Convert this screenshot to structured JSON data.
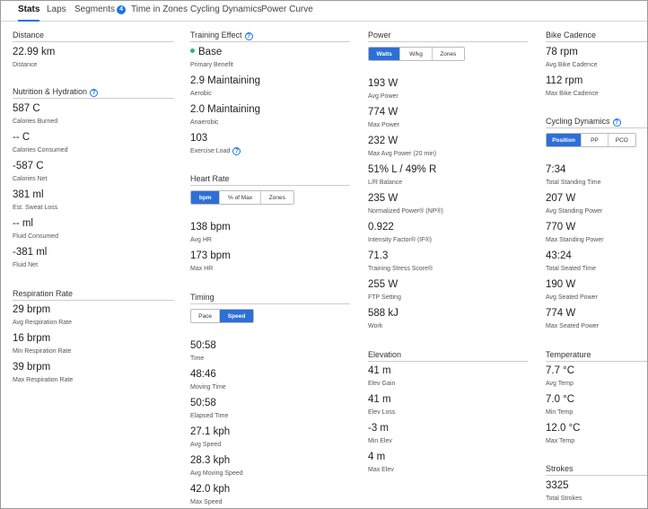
{
  "tabs": [
    {
      "label": "Stats",
      "active": true
    },
    {
      "label": "Laps"
    },
    {
      "label": "Segments",
      "badge": "4"
    },
    {
      "label": "Time in Zones"
    },
    {
      "label": "Cycling Dynamics"
    },
    {
      "label": "Power Curve"
    }
  ],
  "distance": {
    "title": "Distance",
    "items": [
      {
        "value": "22.99 km",
        "label": "Distance"
      }
    ]
  },
  "nutrition": {
    "title": "Nutrition & Hydration",
    "items": [
      {
        "value": "587 C",
        "label": "Calories Burned"
      },
      {
        "value": "-- C",
        "label": "Calories Consumed"
      },
      {
        "value": "-587 C",
        "label": "Calories Net"
      },
      {
        "value": "381 ml",
        "label": "Est. Sweat Loss"
      },
      {
        "value": "-- ml",
        "label": "Fluid Consumed"
      },
      {
        "value": "-381 ml",
        "label": "Fluid Net"
      }
    ]
  },
  "respiration": {
    "title": "Respiration Rate",
    "items": [
      {
        "value": "29 brpm",
        "label": "Avg Respiration Rate"
      },
      {
        "value": "16 brpm",
        "label": "Min Respiration Rate"
      },
      {
        "value": "39 brpm",
        "label": "Max Respiration Rate"
      }
    ]
  },
  "training": {
    "title": "Training Effect",
    "items": [
      {
        "value": "Base",
        "label": "Primary Benefit"
      },
      {
        "value": "2.9 Maintaining",
        "label": "Aerobic"
      },
      {
        "value": "2.0 Maintaining",
        "label": "Anaerobic"
      },
      {
        "value": "103",
        "label": "Exercise Load"
      }
    ],
    "dot_color": "#3bb273"
  },
  "heartrate": {
    "title": "Heart Rate",
    "toggle": [
      "bpm",
      "% of Max",
      "Zones"
    ],
    "items": [
      {
        "value": "138 bpm",
        "label": "Avg HR"
      },
      {
        "value": "173 bpm",
        "label": "Max HR"
      }
    ]
  },
  "timing": {
    "title": "Timing",
    "toggle": [
      "Pace",
      "Speed"
    ],
    "items": [
      {
        "value": "50:58",
        "label": "Time"
      },
      {
        "value": "48:46",
        "label": "Moving Time"
      },
      {
        "value": "50:58",
        "label": "Elapsed Time"
      },
      {
        "value": "27.1 kph",
        "label": "Avg Speed"
      },
      {
        "value": "28.3 kph",
        "label": "Avg Moving Speed"
      },
      {
        "value": "42.0 kph",
        "label": "Max Speed"
      }
    ]
  },
  "power": {
    "title": "Power",
    "toggle": [
      "Watts",
      "W/kg",
      "Zones"
    ],
    "items": [
      {
        "value": "193 W",
        "label": "Avg Power"
      },
      {
        "value": "774 W",
        "label": "Max Power"
      },
      {
        "value": "232 W",
        "label": "Max Avg Power (20 min)"
      },
      {
        "value": "51% L / 49% R",
        "label": "L/R Balance"
      },
      {
        "value": "235 W",
        "label": "Normalized Power® (NP®)"
      },
      {
        "value": "0.922",
        "label": "Intensity Factor® (IF®)"
      },
      {
        "value": "71.3",
        "label": "Training Stress Score®"
      },
      {
        "value": "255 W",
        "label": "FTP Setting"
      },
      {
        "value": "588 kJ",
        "label": "Work"
      }
    ]
  },
  "elevation": {
    "title": "Elevation",
    "items": [
      {
        "value": "41 m",
        "label": "Elev Gain"
      },
      {
        "value": "41 m",
        "label": "Elev Loss"
      },
      {
        "value": "-3 m",
        "label": "Min Elev"
      },
      {
        "value": "4 m",
        "label": "Max Elev"
      }
    ]
  },
  "cadence": {
    "title": "Bike Cadence",
    "items": [
      {
        "value": "78 rpm",
        "label": "Avg Bike Cadence"
      },
      {
        "value": "112 rpm",
        "label": "Max Bike Cadence"
      }
    ]
  },
  "dynamics": {
    "title": "Cycling Dynamics",
    "toggle": [
      "Position",
      "PP",
      "PCO"
    ],
    "items": [
      {
        "value": "7:34",
        "label": "Total Standing Time"
      },
      {
        "value": "207 W",
        "label": "Avg Standing Power"
      },
      {
        "value": "770 W",
        "label": "Max Standing Power"
      },
      {
        "value": "43:24",
        "label": "Total Seated Time"
      },
      {
        "value": "190 W",
        "label": "Avg Seated Power"
      },
      {
        "value": "774 W",
        "label": "Max Seated Power"
      }
    ]
  },
  "temperature": {
    "title": "Temperature",
    "items": [
      {
        "value": "7.7 °C",
        "label": "Avg Temp"
      },
      {
        "value": "7.0 °C",
        "label": "Min Temp"
      },
      {
        "value": "12.0 °C",
        "label": "Max Temp"
      }
    ]
  },
  "strokes": {
    "title": "Strokes",
    "items": [
      {
        "value": "3325",
        "label": "Total Strokes"
      }
    ]
  },
  "colors": {
    "accent": "#2d6fd6",
    "tab_active": "#1a73e8",
    "benefit_dot": "#3bb273"
  }
}
